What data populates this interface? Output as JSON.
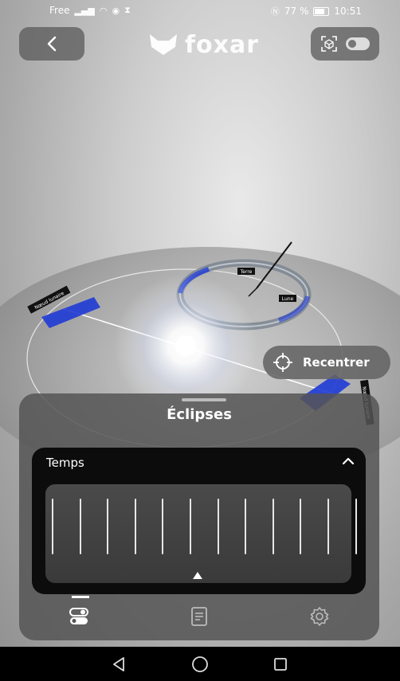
{
  "status_bar": {
    "carrier": "Free",
    "battery_percent": "77 %",
    "time": "10:51"
  },
  "header": {
    "back_icon": "chevron-left-icon",
    "logo_text": "foxar",
    "ar_icon": "ar-cube-icon",
    "ar_toggle_on": true
  },
  "scene_labels": {
    "terre": "Terre",
    "lune": "Lune",
    "left_plane": "Nœud lunaire",
    "right_plane": "Nœud lunaire"
  },
  "recenter": {
    "label": "Recentrer",
    "icon": "crosshair-icon"
  },
  "panel": {
    "title": "Éclipses",
    "time_section": {
      "label": "Temps",
      "expanded": true,
      "tick_count": 12
    }
  },
  "bottom_nav": {
    "items": [
      {
        "icon": "toggles-icon",
        "active": true
      },
      {
        "icon": "document-icon",
        "active": false
      },
      {
        "icon": "settings-icon",
        "active": false
      }
    ]
  },
  "colors": {
    "accent_blue": "#1f3bd6",
    "panel_bg": "#555555",
    "card_bg": "#0c0c0c"
  }
}
